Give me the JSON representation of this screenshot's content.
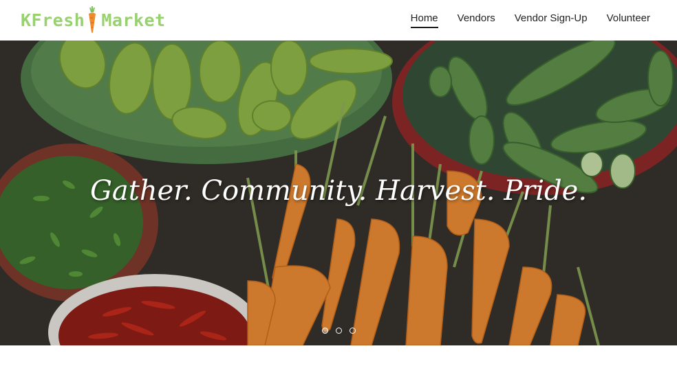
{
  "brand": {
    "name_left": "KFresh",
    "name_right": "Market",
    "color": "#97d26f",
    "icon": "carrot-icon"
  },
  "nav": {
    "items": [
      {
        "label": "Home",
        "active": true
      },
      {
        "label": "Vendors",
        "active": false
      },
      {
        "label": "Vendor Sign-Up",
        "active": false
      },
      {
        "label": "Volunteer",
        "active": false
      }
    ]
  },
  "hero": {
    "tagline": "Gather. Community. Harvest. Pride.",
    "slides_total": 3,
    "active_slide": 1,
    "image": "vegetables-photo"
  }
}
